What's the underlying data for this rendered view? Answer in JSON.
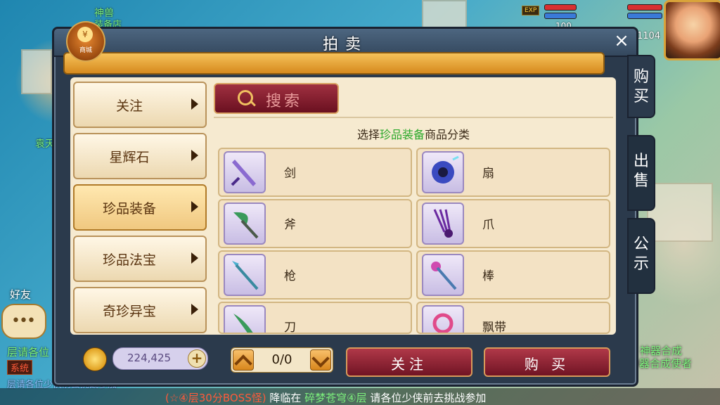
{
  "hud": {
    "npc_top": "神兽",
    "npc_top2": "装备店",
    "exp_badge": "EXP",
    "level_a": "100",
    "level_b": "1104",
    "npc_left": "袁天",
    "friend_label": "好友",
    "npc_right_1": "神器合成",
    "npc_right_2": "神器合成使者"
  },
  "chat": {
    "line1": "层请各位",
    "system_tag": "系统",
    "line2": "层请各位少侠前去挑战参加",
    "marquee_a": "(☆④层30分BOSS怪)",
    "marquee_b": "降临在",
    "marquee_c": "碎梦苍穹④层",
    "marquee_d": "请各位少侠前去挑战参加"
  },
  "dialog": {
    "title": "拍卖",
    "close": "×",
    "shop_label": "商城",
    "shop_coin": "¥",
    "search_label": "搜索",
    "prompt_prefix": "选择",
    "prompt_highlight": "珍品装备",
    "prompt_suffix": "商品分类",
    "categories": [
      "关注",
      "星辉石",
      "珍品装备",
      "珍品法宝",
      "奇珍异宝"
    ],
    "selected_category": "珍品装备",
    "items": [
      "剑",
      "扇",
      "斧",
      "爪",
      "枪",
      "棒",
      "刀",
      "飘带"
    ],
    "tabs": [
      "购买",
      "出售",
      "公示"
    ],
    "money": "224,425",
    "money_plus": "+",
    "pager": "0/0",
    "follow_button": "关注",
    "buy_button": "购 买"
  },
  "colors": {
    "highlight_green": "#2aa82a",
    "dialog_bg": "#2b3a4c",
    "panel_bg": "#f6ead0",
    "button_red": "#8a2030"
  }
}
